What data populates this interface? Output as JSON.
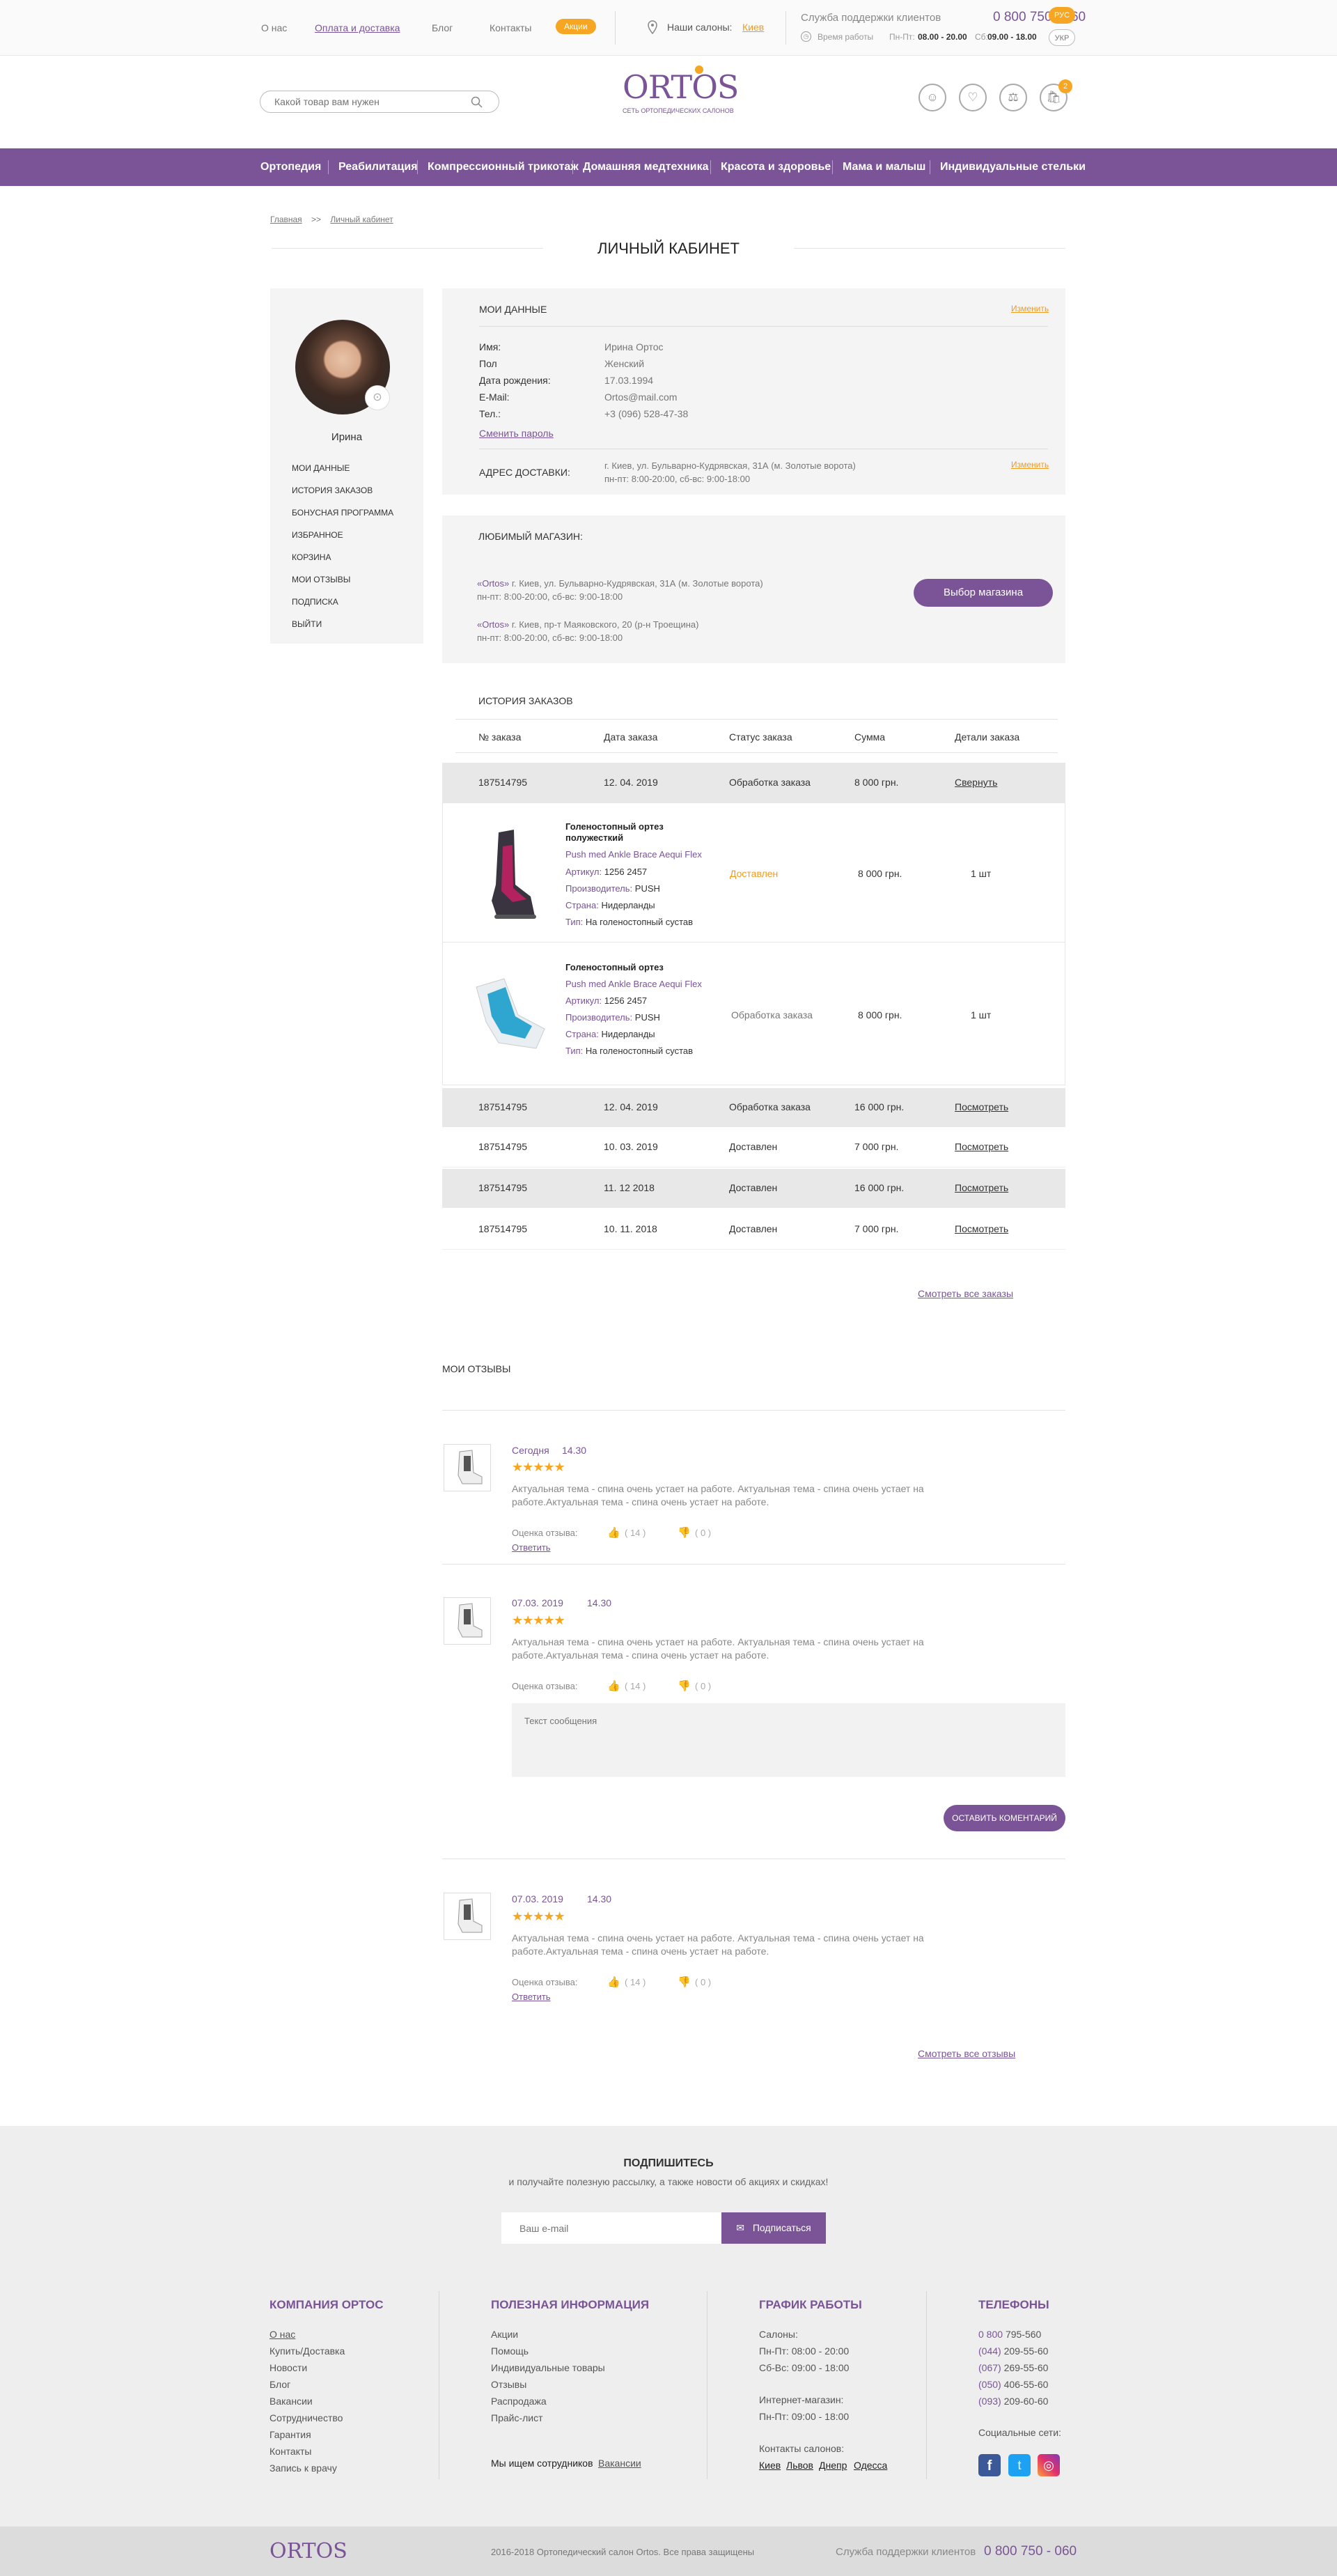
{
  "topbar": {
    "links": [
      "О нас",
      "Оплата и доставка",
      "Блог",
      "Контакты"
    ],
    "promo": "Акции",
    "salons_label": "Наши салоны:",
    "city": "Киев",
    "support_label": "Служба поддержки клиентов",
    "phone": "0 800 750 - 060",
    "hours_label": "Время работы",
    "hours_weekday_label": "Пн-Пт:",
    "hours_weekday": "08.00 - 20.00",
    "hours_sat_label": "Сб:",
    "hours_sat": "09.00 - 18.00",
    "lang_active": "РУС",
    "lang_other": "УКР"
  },
  "header": {
    "search_placeholder": "Какой товар вам нужен",
    "logo_text": "ORTOS",
    "logo_sub": "СЕТЬ ОРТОПЕДИЧЕСКИХ САЛОНОВ",
    "cart_count": "2"
  },
  "nav": [
    "Ортопедия",
    "Реабилитация",
    "Компрессионный трикотаж",
    "Домашняя медтехника",
    "Красота и здоровье",
    "Мама и малыш",
    "Индивидуальные стельки"
  ],
  "breadcrumb": {
    "home": "Главная",
    "sep": ">>",
    "current": "Личный кабинет"
  },
  "page_title": "ЛИЧНЫЙ КАБИНЕТ",
  "sidebar": {
    "name": "Ирина",
    "items": [
      "МОИ ДАННЫЕ",
      "ИСТОРИЯ ЗАКАЗОВ",
      "БОНУСНАЯ ПРОГРАММА",
      "ИЗБРАННОЕ",
      "КОРЗИНА",
      "МОИ ОТЗЫВЫ",
      "ПОДПИСКА",
      "ВЫЙТИ"
    ]
  },
  "my_data": {
    "title": "МОИ ДАННЫЕ",
    "edit": "Изменить",
    "fields": [
      {
        "label": "Имя:",
        "value": "Ирина Ортос"
      },
      {
        "label": "Пол",
        "value": "Женский"
      },
      {
        "label": "Дата рождения:",
        "value": "17.03.1994"
      },
      {
        "label": "E-Mail:",
        "value": "Ortos@mail.com"
      },
      {
        "label": "Тел.:",
        "value": "+3 (096) 528-47-38"
      }
    ],
    "change_password": "Сменить пароль",
    "address_title": "АДРЕС ДОСТАВКИ:",
    "address_line1": "г. Киев,    ул. Бульварно-Кудрявская, 31А (м. Золотые ворота)",
    "address_line2": "пн-пт: 8:00-20:00, сб-вс: 9:00-18:00",
    "address_edit": "Изменить"
  },
  "favorite_store": {
    "title": "ЛЮБИМЫЙ МАГАЗИН:",
    "stores": [
      {
        "brand": "«Ortos»",
        "line1": " г. Киев,    ул. Бульварно-Кудрявская, 31А (м. Золотые ворота)",
        "line2": "пн-пт: 8:00-20:00, сб-вс: 9:00-18:00"
      },
      {
        "brand": "«Ortos»",
        "line1": " г. Киев,    пр-т Маяковского, 20 (р-н Троещина)",
        "line2": "пн-пт: 8:00-20:00, сб-вс: 9:00-18:00"
      }
    ],
    "button": "Выбор магазина"
  },
  "orders": {
    "title": "ИСТОРИЯ ЗАКАЗОВ",
    "headers": [
      "№ заказа",
      "Дата заказа",
      "Статус заказа",
      "Сумма",
      "Детали заказа"
    ],
    "expanded": {
      "no": "187514795",
      "date": "12. 04. 2019",
      "status": "Обработка заказа",
      "sum": "8 000 грн.",
      "link": "Свернуть"
    },
    "items": [
      {
        "name": "Голеностопный ортез полужесткий",
        "model": "Push med Ankle Brace Aequi Flex",
        "art_label": "Артикул:",
        "art": "1256 2457",
        "maker_label": "Производитель:",
        "maker": "PUSH",
        "country_label": "Страна:",
        "country": "Нидерланды",
        "type_label": "Тип:",
        "type": "На голеностопный сустав",
        "status": "Доставлен",
        "sum": "8 000 грн.",
        "qty": "1 шт"
      },
      {
        "name": "Голеностопный ортез",
        "model": "Push med Ankle Brace Aequi Flex",
        "art_label": "Артикул:",
        "art": "1256 2457",
        "maker_label": "Производитель:",
        "maker": "PUSH",
        "country_label": "Страна:",
        "country": "Нидерланды",
        "type_label": "Тип:",
        "type": "На голеностопный сустав",
        "status": "Обработка заказа",
        "sum": "8 000 грн.",
        "qty": "1 шт"
      }
    ],
    "rows": [
      {
        "no": "187514795",
        "date": "12. 04. 2019",
        "status": "Обработка заказа",
        "sum": "16 000 грн.",
        "link": "Посмотреть"
      },
      {
        "no": "187514795",
        "date": "10. 03. 2019",
        "status": "Доставлен",
        "sum": "7 000 грн.",
        "link": "Посмотреть"
      },
      {
        "no": "187514795",
        "date": "11. 12 2018",
        "status": "Доставлен",
        "sum": "16 000 грн.",
        "link": "Посмотреть"
      },
      {
        "no": "187514795",
        "date": "10. 11. 2018",
        "status": "Доставлен",
        "sum": "7 000 грн.",
        "link": "Посмотреть"
      }
    ],
    "see_all": "Смотреть все заказы"
  },
  "reviews": {
    "title": "МОИ ОТЗЫВЫ",
    "rating_label": "Оценка отзыва:",
    "items": [
      {
        "date": "Сегодня",
        "time": "14.30",
        "text1": "Актуальная тема - спина очень устает на работе. Актуальная тема - спина очень устает на",
        "text2": "работе.Актуальная тема - спина очень устает на работе.",
        "likes": "( 14 )",
        "dislikes": "( 0 )",
        "reply": "Ответить"
      },
      {
        "date": "07.03. 2019",
        "time": "14.30",
        "text1": "Актуальная тема - спина очень устает на работе. Актуальная тема - спина очень устает на",
        "text2": "работе.Актуальная тема - спина очень устает на работе.",
        "likes": "( 14 )",
        "dislikes": "( 0 )"
      },
      {
        "date": "07.03. 2019",
        "time": "14.30",
        "text1": "Актуальная тема - спина очень устает на работе. Актуальная тема - спина очень устает на",
        "text2": "работе.Актуальная тема - спина очень устает на работе.",
        "likes": "( 14 )",
        "dislikes": "( 0 )",
        "reply": "Ответить"
      }
    ],
    "textarea_placeholder": "Текст сообщения",
    "leave_comment": "ОСТАВИТЬ КОМЕНТАРИЙ",
    "see_all": "Смотреть все отзывы"
  },
  "subscribe": {
    "title": "ПОДПИШИТЕСЬ",
    "subtitle": "и получайте полезную рассылку, а также новости об акциях и скидках!",
    "placeholder": "Ваш e-mail",
    "button": "Подписаться"
  },
  "footer": {
    "company_title": "КОМПАНИЯ ОРТОС",
    "company_links": [
      "О нас",
      "Купить/Доставка",
      "Новости",
      "Блог",
      "Вакансии",
      "Сотрудничество",
      "Гарантия",
      "Контакты",
      "Запись к врачу"
    ],
    "info_title": "ПОЛЕЗНАЯ ИНФОРМАЦИЯ",
    "info_links": [
      "Акции",
      "Помощь",
      "Индивидуальные товары",
      "Отзывы",
      "Распродажа",
      "Прайс-лист"
    ],
    "hiring_text": "Мы ищем сотрудников",
    "hiring_link": "Вакансии",
    "schedule_title": "ГРАФИК РАБОТЫ",
    "salons_label": "Салоны:",
    "salons_h1": "Пн-Пт: 08:00 - 20:00",
    "salons_h2": "Сб-Вс: 09:00 - 18:00",
    "shop_label": "Интернет-магазин:",
    "shop_h": "Пн-Пт: 09:00 - 18:00",
    "contacts_label": "Контакты салонов:",
    "cities": [
      "Киев",
      "Львов",
      "Днепр",
      "Одесса"
    ],
    "phones_title": "ТЕЛЕФОНЫ",
    "phones": [
      {
        "code": "0 800",
        "num": "795-560"
      },
      {
        "code": "(044)",
        "num": "209-55-60"
      },
      {
        "code": "(067)",
        "num": "269-55-60"
      },
      {
        "code": "(050)",
        "num": "406-55-60"
      },
      {
        "code": "(093)",
        "num": "209-60-60"
      }
    ],
    "social_title": "Социальные сети:",
    "copyright": "2016-2018 Ортопедический салон Ortos. Все права защищены",
    "support_label": "Служба поддержки клиентов",
    "phone": "0 800 750 - 060"
  },
  "colors": {
    "brand": "#7a5497",
    "accent": "#f6a623",
    "orange_text": "#f29a1d"
  }
}
